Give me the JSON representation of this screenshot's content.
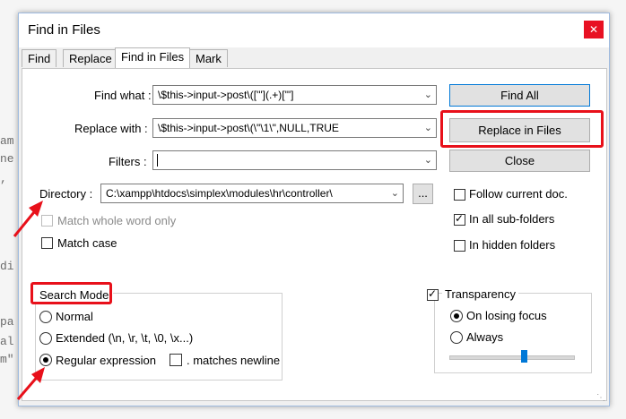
{
  "background_code": [
    "am",
    "ne",
    ",",
    "",
    "",
    "di",
    "",
    "pa",
    "al",
    "m\""
  ],
  "window": {
    "title": "Find in Files",
    "close_glyph": "✕"
  },
  "tabs": [
    "Find",
    "Replace",
    "Find in Files",
    "Mark"
  ],
  "fields": {
    "find_label": "Find what :",
    "find_value": "\\$this->input->post\\(['\"](.+)['\"]",
    "replace_label": "Replace with :",
    "replace_value": "\\$this->input->post\\(\\\"\\1\\\",NULL,TRUE",
    "filters_label": "Filters :",
    "filters_value": "",
    "directory_label": "Directory :",
    "directory_value": "C:\\xampp\\htdocs\\simplex\\modules\\hr\\controller\\",
    "browse_label": "..."
  },
  "buttons": {
    "find_all": "Find All",
    "replace_in_files": "Replace in Files",
    "close": "Close"
  },
  "checks": {
    "match_whole_word": "Match whole word only",
    "match_case": "Match case",
    "follow_current": "Follow current doc.",
    "in_all_subfolders": "In all sub-folders",
    "in_hidden_folders": "In hidden folders",
    "matches_newline": ". matches newline"
  },
  "search_mode": {
    "title": "Search Mode",
    "normal": "Normal",
    "extended": "Extended (\\n, \\r, \\t, \\0, \\x...)",
    "regex": "Regular expression"
  },
  "transparency": {
    "title": "Transparency",
    "on_losing_focus": "On losing focus",
    "always": "Always",
    "slider_level": 0.6
  },
  "colors": {
    "annotation_red": "#e8101a",
    "close_red": "#e81123",
    "accent_blue": "#0078d7"
  }
}
